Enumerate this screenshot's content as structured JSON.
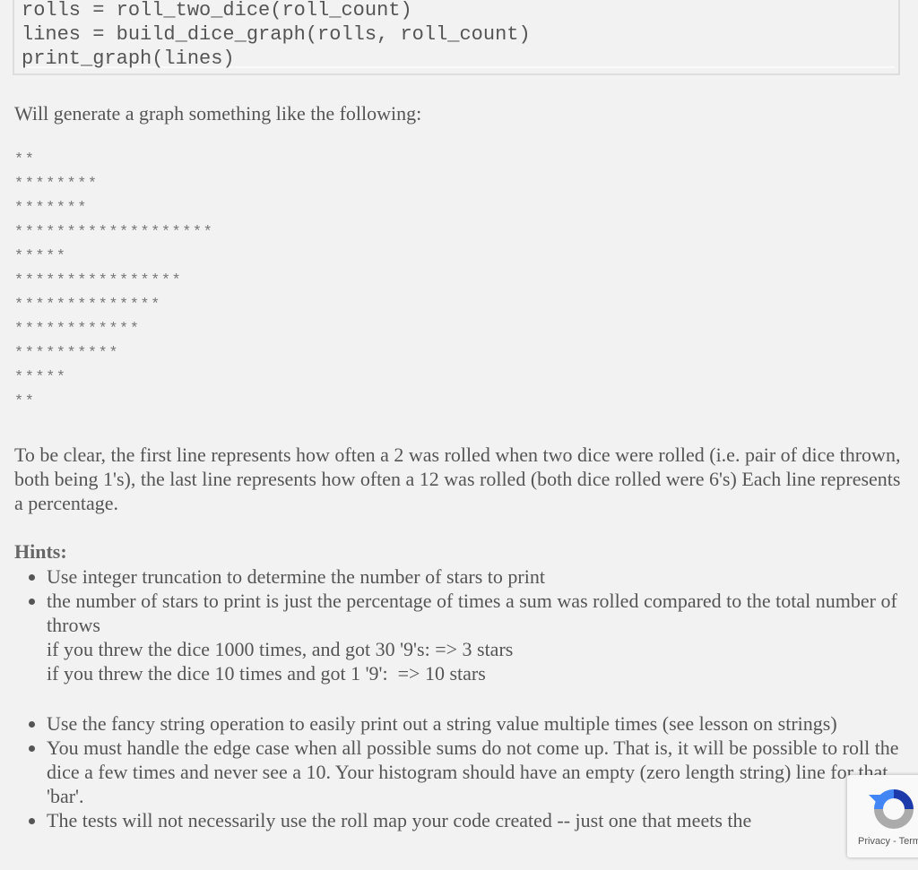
{
  "code": {
    "lines": [
      "rolls = roll_two_dice(roll_count)",
      "lines = build_dice_graph(rolls, roll_count)",
      "print_graph(lines)"
    ]
  },
  "intro": "Will generate a graph something like the following:",
  "graph_lines": [
    "**",
    "********",
    "*******",
    "*******************",
    "*****",
    "****************",
    "**************",
    "************",
    "**********",
    "*****",
    "**"
  ],
  "explanation": "To be clear, the first line represents how often a 2 was rolled when two dice were rolled (i.e. pair of dice thrown, both being 1's), the last line represents how often a 12 was rolled (both dice rolled were 6's) Each line represents a percentage.",
  "hints": {
    "title": "Hints:",
    "items": [
      {
        "text": "Use integer truncation to determine the number of stars to print"
      },
      {
        "text": "the number of stars to print is just the percentage of times a sum was rolled compared to the total number of throws",
        "sub": [
          "if you threw the dice 1000 times, and got 30 '9's: => 3 stars",
          "if you threw the dice 10 times and got 1 '9':  => 10 stars"
        ]
      },
      {
        "text": "Use the fancy string operation to easily print out a string value multiple times (see lesson on strings)"
      },
      {
        "text": "You must handle the edge case when all possible sums do not come up.  That is, it will be possible to roll the dice a few times and never see a 10.  Your histogram should have an empty (zero length string) line for that 'bar'."
      },
      {
        "text": "The tests will not necessarily use the roll map your code created -- just one that meets the"
      }
    ]
  },
  "recaptcha": {
    "label": "Privacy - Terms",
    "icon": "recaptcha-icon"
  }
}
